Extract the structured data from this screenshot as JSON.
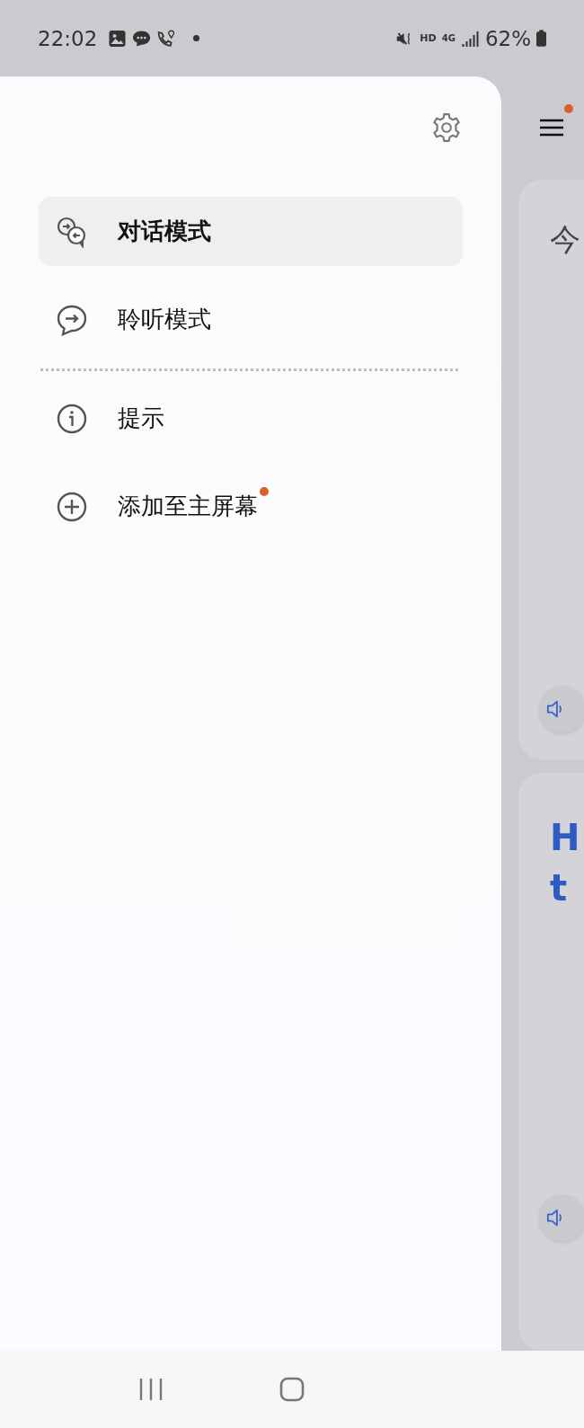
{
  "status_bar": {
    "time": "22:02",
    "hd": "HD",
    "network": "4G",
    "battery": "62%"
  },
  "drawer": {
    "sections": [
      [
        {
          "label": "对话模式",
          "kind": "conversation",
          "selected": true,
          "badge": false
        },
        {
          "label": "聆听模式",
          "kind": "listen",
          "selected": false,
          "badge": false
        }
      ],
      [
        {
          "label": "提示",
          "kind": "info",
          "selected": false,
          "badge": false
        },
        {
          "label": "添加至主屏幕",
          "kind": "add",
          "selected": false,
          "badge": true
        }
      ]
    ]
  },
  "main": {
    "menu_badge": true,
    "cards": [
      {
        "kind": "plain",
        "lines": [
          "今"
        ]
      },
      {
        "kind": "heading",
        "lines": [
          "H",
          "t"
        ]
      }
    ]
  }
}
